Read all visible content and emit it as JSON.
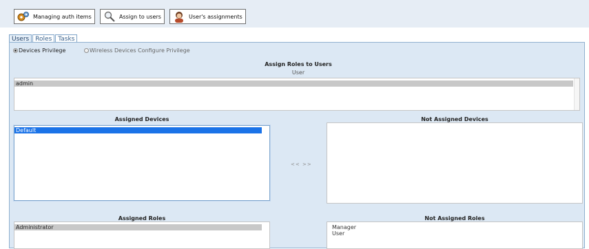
{
  "toolbar": {
    "managing_label": "Managing auth items",
    "assign_label": "Assign to users",
    "assignments_label": "User's assignments"
  },
  "tabs": [
    {
      "label": "Users",
      "active": true
    },
    {
      "label": "Roles",
      "active": false
    },
    {
      "label": "Tasks",
      "active": false
    }
  ],
  "privilege": {
    "options": [
      {
        "label": "Devices Privilege",
        "checked": true
      },
      {
        "label": "Wireless Devices Configure Privilege",
        "checked": false
      }
    ]
  },
  "assign": {
    "title": "Assign Roles to Users",
    "user_label": "User",
    "users": [
      "admin"
    ]
  },
  "devices": {
    "assigned_title": "Assigned Devices",
    "assigned": [
      "Default"
    ],
    "not_assigned_title": "Not Assigned Devices",
    "not_assigned": [],
    "move_controls": "<< >>"
  },
  "roles": {
    "assigned_title": "Assigned Roles",
    "assigned": [
      "Administrator"
    ],
    "not_assigned_title": "Not Assigned Roles",
    "not_assigned": [
      "Manager",
      "User"
    ]
  },
  "colors": {
    "panel": "#dce8f4",
    "tab_border": "#7fa4c8",
    "selection_blue": "#1a73e8",
    "selection_gray": "#c8c8c8"
  }
}
